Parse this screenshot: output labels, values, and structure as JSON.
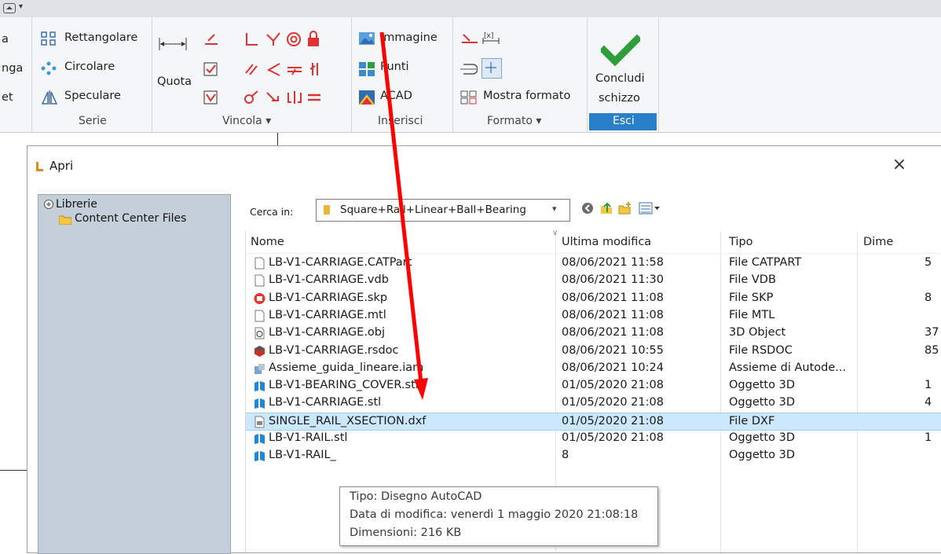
{
  "ribbon": {
    "left_cut": [
      "a",
      "nga",
      "et"
    ],
    "serie": {
      "items": [
        "Rettangolare",
        "Circolare",
        "Speculare"
      ],
      "label": "Serie"
    },
    "vincola": {
      "quota_label": "Quota",
      "label": "Vincola",
      "dropdown": "▾"
    },
    "inserisci": {
      "items": [
        "Immagine",
        "Punti",
        "ACAD"
      ],
      "label": "Inserisci"
    },
    "formato": {
      "item": "Mostra formato",
      "label": "Formato",
      "dropdown": "▾"
    },
    "esci": {
      "line1": "Concludi",
      "line2": "schizzo",
      "label": "Esci",
      "accent": "#2a7fc9"
    }
  },
  "dialog": {
    "title": "Apri",
    "close": "×",
    "tree": {
      "root": "Librerie",
      "child": "Content Center Files"
    },
    "lookin_label": "Cerca in:",
    "lookin_value": "Square+Rail+Linear+Ball+Bearing",
    "columns": [
      "Nome",
      "Ultima modifica",
      "Tipo",
      "Dime"
    ],
    "files": [
      {
        "name": "LB-V1-CARRIAGE.CATPart",
        "date": "08/06/2021 11:58",
        "type": "File CATPART",
        "size": "5",
        "icon": "blank-file-icon"
      },
      {
        "name": "LB-V1-CARRIAGE.vdb",
        "date": "08/06/2021 11:30",
        "type": "File VDB",
        "size": "",
        "icon": "blank-file-icon"
      },
      {
        "name": "LB-V1-CARRIAGE.skp",
        "date": "08/06/2021 11:08",
        "type": "File SKP",
        "size": "8",
        "icon": "sketchup-icon"
      },
      {
        "name": "LB-V1-CARRIAGE.mtl",
        "date": "08/06/2021 11:08",
        "type": "File MTL",
        "size": "",
        "icon": "blank-file-icon"
      },
      {
        "name": "LB-V1-CARRIAGE.obj",
        "date": "08/06/2021 11:08",
        "type": "3D Object",
        "size": "37",
        "icon": "3d-object-icon"
      },
      {
        "name": "LB-V1-CARRIAGE.rsdoc",
        "date": "08/06/2021 10:55",
        "type": "File RSDOC",
        "size": "85",
        "icon": "rsdoc-icon"
      },
      {
        "name": "Assieme_guida_lineare.iam",
        "date": "08/06/2021 10:24",
        "type": "Assieme di Autode...",
        "size": "",
        "icon": "assembly-icon"
      },
      {
        "name": "LB-V1-BEARING_COVER.stl",
        "date": "01/05/2020 21:08",
        "type": "Oggetto 3D",
        "size": "1",
        "icon": "stl-icon"
      },
      {
        "name": "LB-V1-CARRIAGE.stl",
        "date": "01/05/2020 21:08",
        "type": "Oggetto 3D",
        "size": "4",
        "icon": "stl-icon"
      },
      {
        "name": "SINGLE_RAIL_XSECTION.dxf",
        "date": "01/05/2020 21:08",
        "type": "File DXF",
        "size": "",
        "icon": "dxf-icon",
        "selected": true
      },
      {
        "name": "LB-V1-RAIL.stl",
        "date": "01/05/2020 21:08",
        "type": "Oggetto 3D",
        "size": "1",
        "icon": "stl-icon"
      },
      {
        "name": "LB-V1-RAIL_",
        "date": "8",
        "type": "Oggetto 3D",
        "size": "",
        "icon": "stl-icon"
      }
    ],
    "tooltip": {
      "line1": "Tipo: Disegno AutoCAD",
      "line2": "Data di modifica: venerdì 1 maggio 2020 21:08:18",
      "line3": "Dimensioni: 216 KB"
    }
  },
  "colors": {
    "annotation_arrow": "#ff0000",
    "selection": "#cce8ff",
    "left_pane": "#c5cfd9",
    "check": "#2e9e3b"
  }
}
